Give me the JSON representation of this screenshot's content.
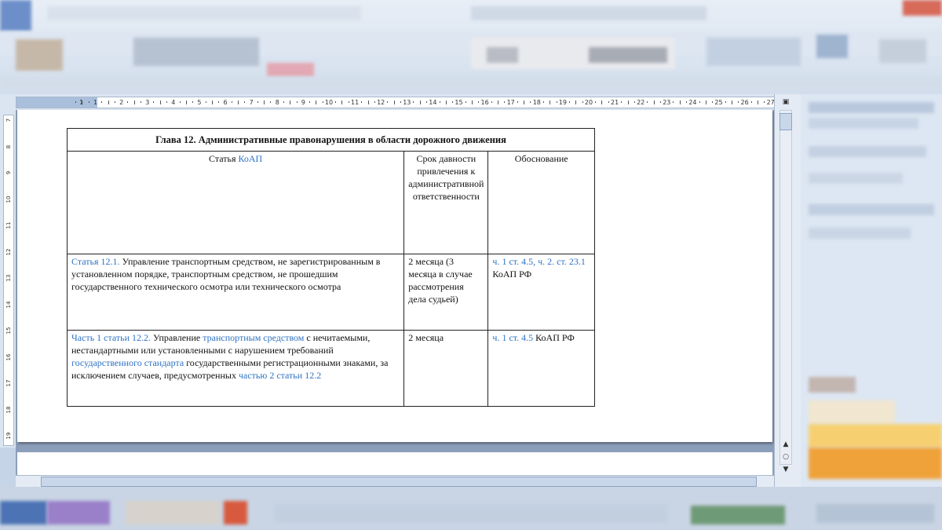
{
  "ruler": {
    "corner_icon": "tab-stop-icon",
    "h_numbers": [
      "1",
      "1",
      "2",
      "3",
      "4",
      "5",
      "6",
      "7",
      "8",
      "9",
      "10",
      "11",
      "12",
      "13",
      "14",
      "15",
      "16",
      "17",
      "18",
      "19",
      "20",
      "21",
      "22",
      "23",
      "24",
      "25",
      "26",
      "27"
    ],
    "v_numbers": [
      "7",
      "8",
      "9",
      "10",
      "11",
      "12",
      "13",
      "14",
      "15",
      "16",
      "17",
      "18",
      "19"
    ]
  },
  "table": {
    "title": "Глава 12. Административные правонарушения в области дорожного движения",
    "headers": {
      "article_prefix": "Статья ",
      "article_link": "КоАП",
      "term": "Срок давности привлечения к административной ответственности",
      "basis": "Обоснование"
    },
    "rows": [
      {
        "article": [
          {
            "text": "Статья 12.1.",
            "link": true
          },
          {
            "text": " Управление транспортным средством, не зарегистрированным в установленном порядке, транспортным средством, не прошедшим государственного технического осмотра или технического осмотра",
            "link": false
          }
        ],
        "term": "2 месяца (3 месяца в случае рассмотрения дела судьей)",
        "basis": [
          {
            "text": "ч. 1 ст. 4.5",
            "link": true
          },
          {
            "text": ", ",
            "link": true
          },
          {
            "text": "ч. 2. ст. 23.1",
            "link": true
          },
          {
            "text": " КоАП РФ",
            "link": false
          }
        ]
      },
      {
        "article": [
          {
            "text": "Часть 1 статьи 12.2.",
            "link": true
          },
          {
            "text": " Управление ",
            "link": false
          },
          {
            "text": "транспортным средством",
            "link": true
          },
          {
            "text": " с нечитаемыми, нестандартными или установленными с нарушением требований ",
            "link": false
          },
          {
            "text": "государственного стандарта",
            "link": true
          },
          {
            "text": " государственными регистрационными знаками, за исключением случаев, предусмотренных ",
            "link": false
          },
          {
            "text": "частью 2 статьи 12.2",
            "link": true
          }
        ],
        "term": "2 месяца",
        "basis": [
          {
            "text": "ч. 1 ст. 4.5",
            "link": true
          },
          {
            "text": " КоАП РФ",
            "link": false
          }
        ]
      }
    ]
  },
  "scrollbar": {
    "up_icon": "arrow-up-icon",
    "down_icon": "arrow-down-icon",
    "browse_icon": "select-browse-object-icon"
  }
}
